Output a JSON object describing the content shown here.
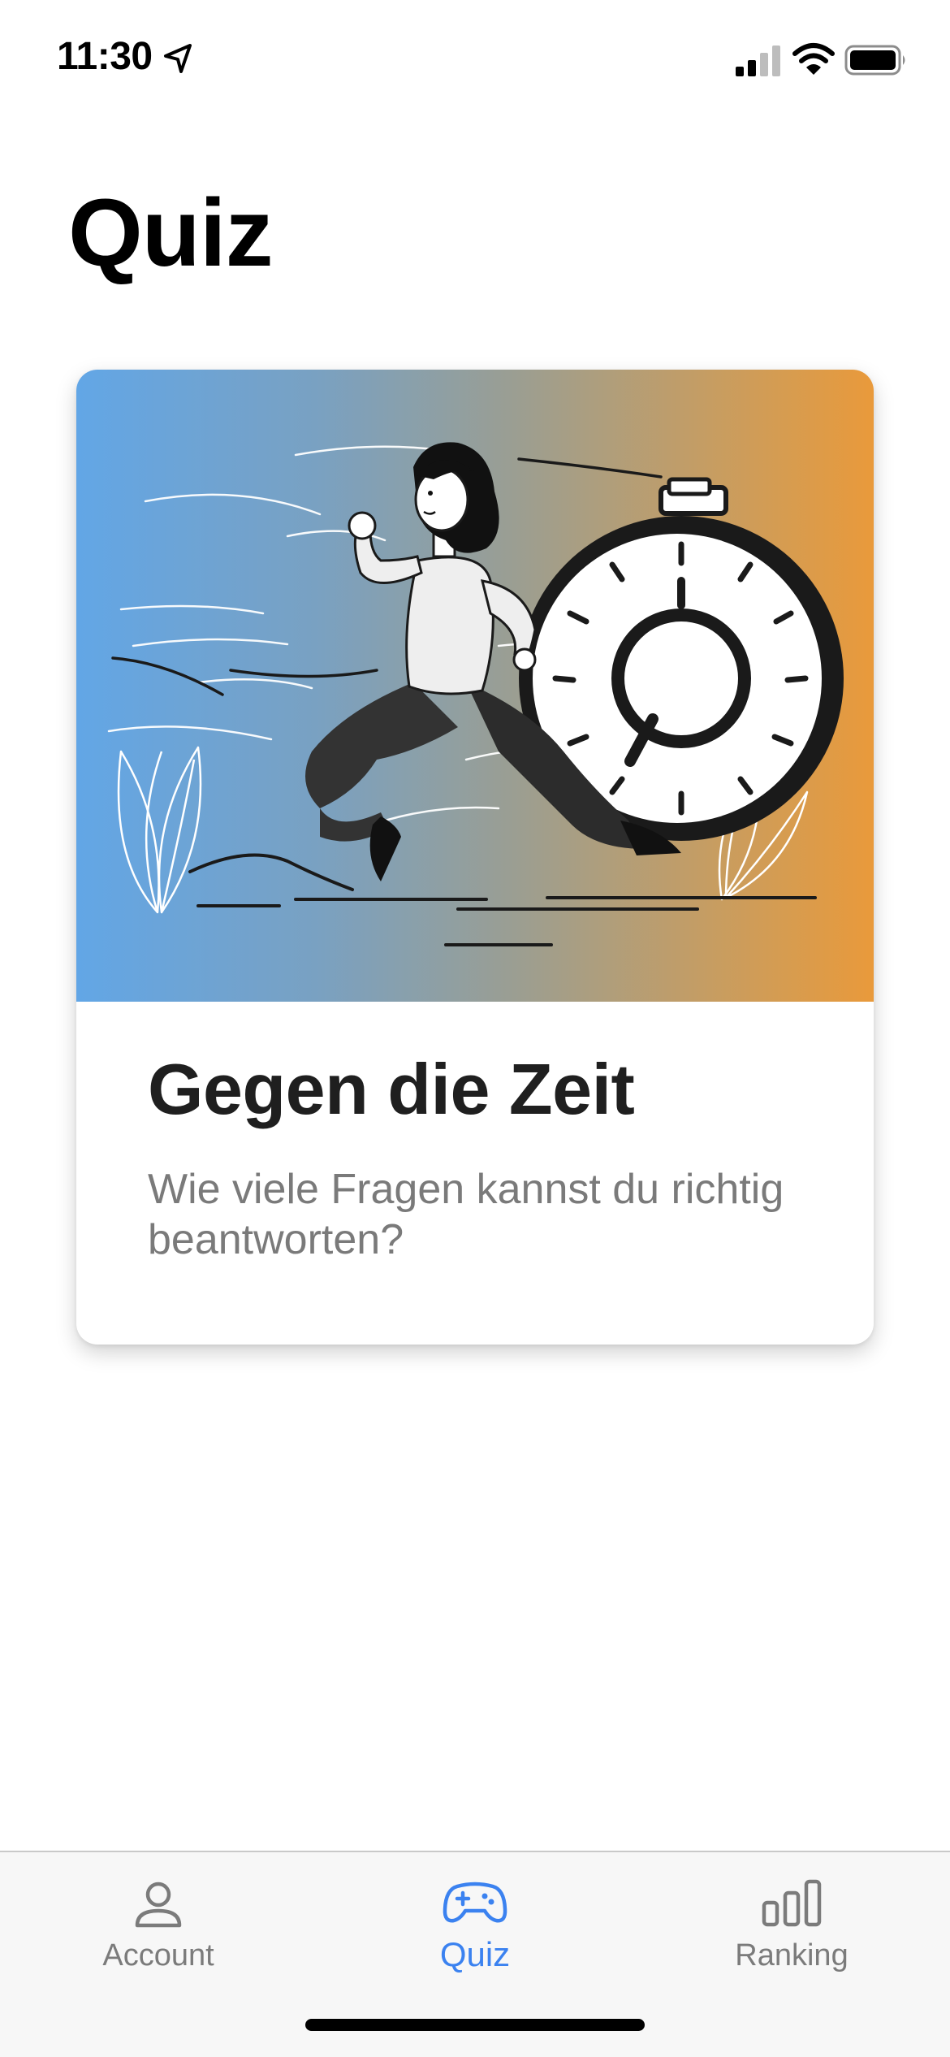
{
  "status_bar": {
    "time": "11:30",
    "icons": [
      "location-arrow-icon",
      "cellular-signal-icon",
      "wifi-icon",
      "battery-icon"
    ]
  },
  "header": {
    "title": "Quiz"
  },
  "quiz_card": {
    "title": "Gegen die Zeit",
    "description": "Wie viele Fragen kannst du richtig beantworten?",
    "illustration": "woman-running-from-stopwatch-illustration",
    "gradient_colors": [
      "#62a6e6",
      "#e99a3b"
    ]
  },
  "tab_bar": {
    "items": [
      {
        "label": "Account",
        "icon": "person-icon",
        "active": false
      },
      {
        "label": "Quiz",
        "icon": "gamepad-icon",
        "active": true
      },
      {
        "label": "Ranking",
        "icon": "bar-chart-icon",
        "active": false
      }
    ],
    "active_color": "#3b82f0",
    "inactive_color": "#7b7b7b"
  }
}
